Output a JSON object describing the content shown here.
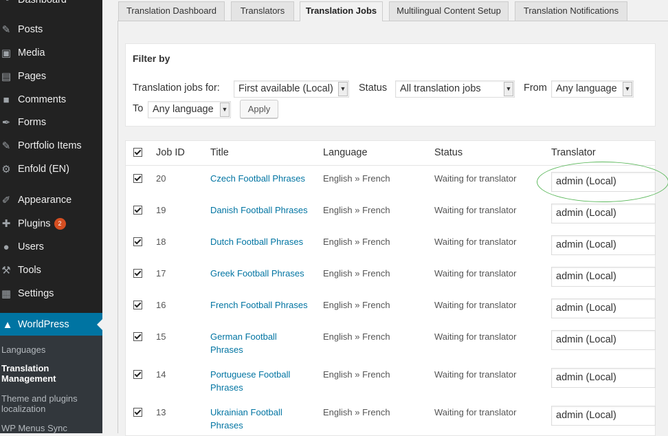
{
  "sidebar": {
    "items": [
      {
        "label": "Dashboard",
        "icon": "dashboard-icon"
      },
      {
        "label": "Posts",
        "icon": "pin-icon"
      },
      {
        "label": "Media",
        "icon": "media-icon"
      },
      {
        "label": "Pages",
        "icon": "pages-icon"
      },
      {
        "label": "Comments",
        "icon": "comment-icon"
      },
      {
        "label": "Forms",
        "icon": "feather-icon"
      },
      {
        "label": "Portfolio Items",
        "icon": "pin-icon"
      },
      {
        "label": "Enfold (EN)",
        "icon": "gear-icon"
      },
      {
        "label": "Appearance",
        "icon": "paintbrush-icon"
      },
      {
        "label": "Plugins",
        "icon": "plugin-icon",
        "badge": "2"
      },
      {
        "label": "Users",
        "icon": "user-icon"
      },
      {
        "label": "Tools",
        "icon": "wrench-icon"
      },
      {
        "label": "Settings",
        "icon": "settings-icon"
      }
    ],
    "current": {
      "label": "WorldPress",
      "icon": "wpml-icon"
    },
    "submenu": [
      "Languages",
      "Translation Management",
      "Theme and plugins localization",
      "WP Menus Sync"
    ]
  },
  "tabs": [
    "Translation Dashboard",
    "Translators",
    "Translation Jobs",
    "Multilingual Content Setup",
    "Translation Notifications"
  ],
  "filter": {
    "heading": "Filter by",
    "jobs_for_label": "Translation jobs for:",
    "jobs_for_value": "First available (Local)",
    "status_label": "Status",
    "status_value": "All translation jobs",
    "from_label": "From",
    "from_value": "Any language",
    "to_label": "To",
    "to_value": "Any language",
    "apply_label": "Apply"
  },
  "table": {
    "headers": {
      "job_id": "Job ID",
      "title": "Title",
      "language": "Language",
      "status": "Status",
      "translator": "Translator"
    },
    "rows": [
      {
        "id": "20",
        "title": "Czech Football Phrases",
        "language": "English » French",
        "status": "Waiting for translator",
        "translator": "admin (Local)"
      },
      {
        "id": "19",
        "title": "Danish Football Phrases",
        "language": "English » French",
        "status": "Waiting for translator",
        "translator": "admin (Local)"
      },
      {
        "id": "18",
        "title": "Dutch Football Phrases",
        "language": "English » French",
        "status": "Waiting for translator",
        "translator": "admin (Local)"
      },
      {
        "id": "17",
        "title": "Greek Football Phrases",
        "language": "English » French",
        "status": "Waiting for translator",
        "translator": "admin (Local)"
      },
      {
        "id": "16",
        "title": "French Football Phrases",
        "language": "English » French",
        "status": "Waiting for translator",
        "translator": "admin (Local)"
      },
      {
        "id": "15",
        "title": "German Football Phrases",
        "language": "English » French",
        "status": "Waiting for translator",
        "translator": "admin (Local)"
      },
      {
        "id": "14",
        "title": "Portuguese Football Phrases",
        "language": "English » French",
        "status": "Waiting for translator",
        "translator": "admin (Local)"
      },
      {
        "id": "13",
        "title": "Ukrainian Football Phrases",
        "language": "English » French",
        "status": "Waiting for translator",
        "translator": "admin (Local)"
      }
    ]
  },
  "colors": {
    "sidebar_bg": "#222222",
    "current_menu": "#0074a2",
    "link": "#0074a2",
    "badge": "#d54e21",
    "highlight_ellipse": "#5cb85c"
  }
}
